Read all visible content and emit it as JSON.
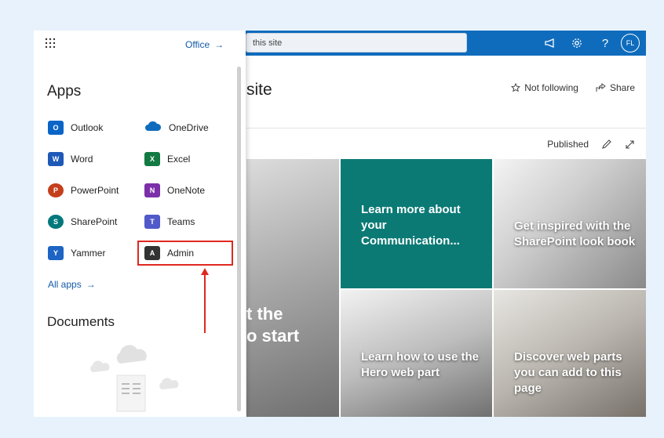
{
  "suitebar": {
    "search_value": "this site",
    "avatar_initials": "FL",
    "help_label": "?",
    "accent": "#0f6cbd"
  },
  "site": {
    "title_fragment": "site",
    "not_following": "Not following",
    "share": "Share",
    "published": "Published"
  },
  "tiles": {
    "hero_line1": "t the",
    "hero_line2": "o start",
    "learn": "Learn more about your Communication...",
    "inspire": "Get inspired with the SharePoint look book",
    "howto": "Learn how to use the Hero web part",
    "discover": "Discover web parts you can add to this page"
  },
  "launcher": {
    "office_link": "Office",
    "apps_heading": "Apps",
    "apps": [
      {
        "label": "Outlook",
        "letter": "O",
        "color": "#0a64c8",
        "icon": "outlook-icon"
      },
      {
        "label": "OneDrive",
        "letter": "",
        "color": "#0f6cbd",
        "icon": "onedrive-icon"
      },
      {
        "label": "Word",
        "letter": "W",
        "color": "#1f59b7",
        "icon": "word-icon"
      },
      {
        "label": "Excel",
        "letter": "X",
        "color": "#137a43",
        "icon": "excel-icon"
      },
      {
        "label": "PowerPoint",
        "letter": "P",
        "color": "#c43e1c",
        "icon": "powerpoint-icon"
      },
      {
        "label": "OneNote",
        "letter": "N",
        "color": "#7b2fa8",
        "icon": "onenote-icon"
      },
      {
        "label": "SharePoint",
        "letter": "S",
        "color": "#03787c",
        "icon": "sharepoint-icon"
      },
      {
        "label": "Teams",
        "letter": "T",
        "color": "#5059c9",
        "icon": "teams-icon"
      },
      {
        "label": "Yammer",
        "letter": "Y",
        "color": "#1d64c4",
        "icon": "yammer-icon"
      },
      {
        "label": "Admin",
        "letter": "A",
        "color": "#333333",
        "icon": "admin-icon"
      }
    ],
    "all_apps": "All apps",
    "documents_heading": "Documents"
  },
  "annotation": {
    "highlight_color": "#e0281f"
  }
}
